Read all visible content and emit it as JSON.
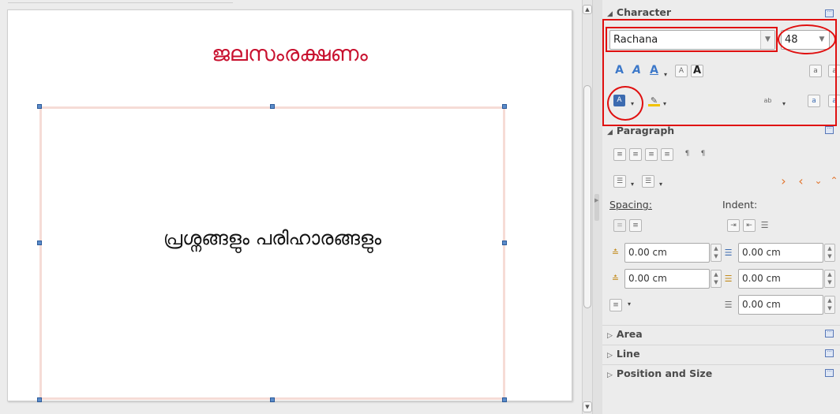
{
  "slide": {
    "title": "ജലസംരക്ഷണം",
    "body": "പ്രശ്നങ്ങളും പരിഹാരങ്ങളും"
  },
  "sidebar": {
    "character": {
      "header": "Character",
      "font_name": "Rachana",
      "font_size": "48"
    },
    "paragraph": {
      "header": "Paragraph",
      "spacing_label": "Spacing:",
      "indent_label": "Indent:",
      "above_spacing": "0.00 cm",
      "below_spacing": "0.00 cm",
      "before_indent": "0.00 cm",
      "after_indent": "0.00 cm",
      "first_line_indent": "0.00 cm"
    },
    "collapsed_sections": [
      "Area",
      "Line",
      "Position and Size"
    ]
  },
  "colors": {
    "title_red": "#c8102e",
    "annotation_red": "#e01010",
    "arrow_orange": "#e2742c",
    "handle_blue": "#5b8cc9"
  }
}
